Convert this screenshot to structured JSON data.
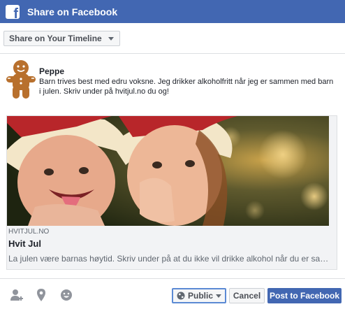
{
  "header": {
    "title": "Share on Facebook",
    "logo_icon": "facebook-logo-icon"
  },
  "destination": {
    "label": "Share on Your Timeline"
  },
  "post": {
    "author": "Peppe",
    "avatar_icon": "gingerbread-man-icon",
    "message": "Barn trives best med edru voksne. Jeg drikker alkoholfritt når jeg er sammen med barn i julen. Skriv under på hvitjul.no du og!"
  },
  "link_preview": {
    "image": "photo-two-children-in-santa-hats",
    "domain": "HVITJUL.NO",
    "title": "Hvit Jul",
    "description": "La julen være barnas høytid. Skriv under på at du ikke vil drikke alkohol når du er sammen med barn i julen."
  },
  "footer": {
    "icons": [
      "tag-friends-icon",
      "location-pin-icon",
      "feeling-emoji-icon"
    ],
    "privacy_label": "Public",
    "cancel_label": "Cancel",
    "post_label": "Post to Facebook"
  },
  "colors": {
    "brand": "#4267b2",
    "border": "#dddfe2",
    "focus": "#5b8ad4"
  }
}
